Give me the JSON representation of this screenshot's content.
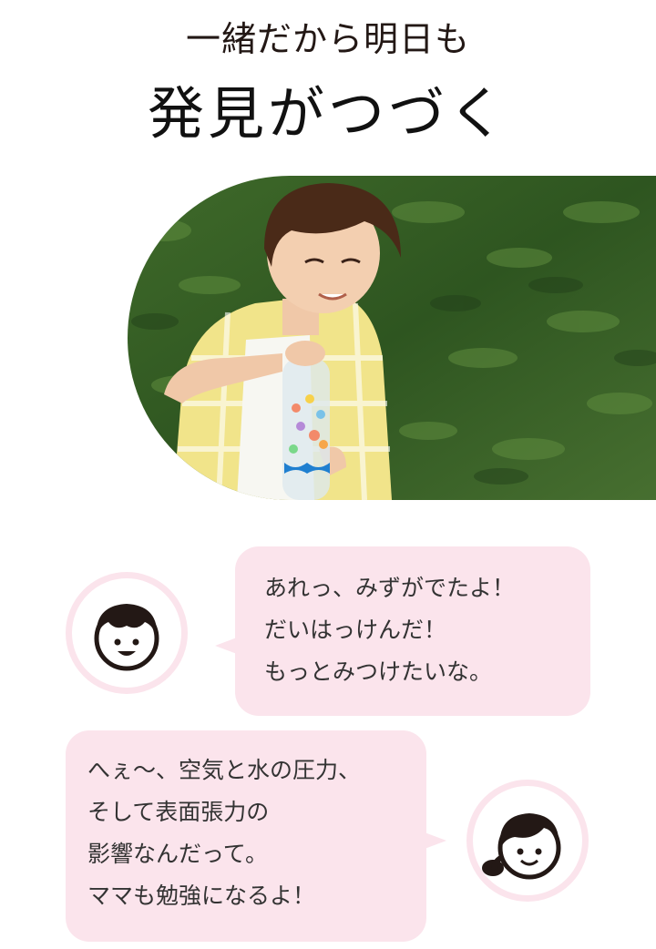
{
  "headline": {
    "line1": "一緒だから明日も",
    "line2": "発見がつづく"
  },
  "photo": {
    "alt": "男の子がペットボトルのおもちゃで遊んでいる写真"
  },
  "dialogue": [
    {
      "speaker": "boy",
      "avatar_icon": "boy-face-icon",
      "lines": [
        "あれっ、みずがでたよ！",
        "だいはっけんだ！",
        "もっとみつけたいな。"
      ]
    },
    {
      "speaker": "mama",
      "avatar_icon": "girl-face-icon",
      "lines": [
        "へぇ〜、空気と水の圧力、",
        "そして表面張力の",
        "影響なんだって。",
        "ママも勉強になるよ！"
      ]
    }
  ],
  "colors": {
    "bubble": "#fbe4ec",
    "avatar_ring": "#fbe4ec",
    "text": "#333333",
    "heading": "#231815"
  }
}
